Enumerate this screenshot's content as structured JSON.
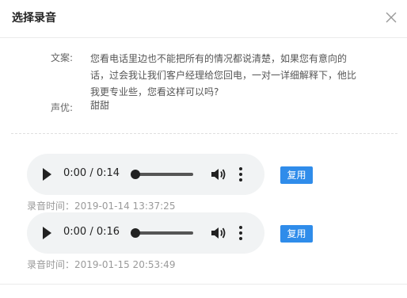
{
  "dialog": {
    "title": "选择录音",
    "close_icon": "close-icon"
  },
  "script": {
    "copy_label": "文案:",
    "copy_lines": [
      "您看电话里边也不能把所有的情况都说清楚，如果您有意向的",
      "话，过会我让我们客户经理给您回电，一对一详细解释下，他比",
      "我更专业些，您看这样可以吗?"
    ],
    "voice_label": "声优:",
    "voice_value": "甜甜"
  },
  "recordings": [
    {
      "time_display": "0:00 / 0:14",
      "progress": 0,
      "use_button": "复用",
      "record_time": "录音时间：2019-01-14 13:37:25"
    },
    {
      "time_display": "0:00 / 0:16",
      "progress": 0,
      "use_button": "复用",
      "record_time": "录音时间：2019-01-15 20:53:49"
    }
  ],
  "colors": {
    "primary": "#2f8cea",
    "player_bg": "#f1f3f4"
  }
}
